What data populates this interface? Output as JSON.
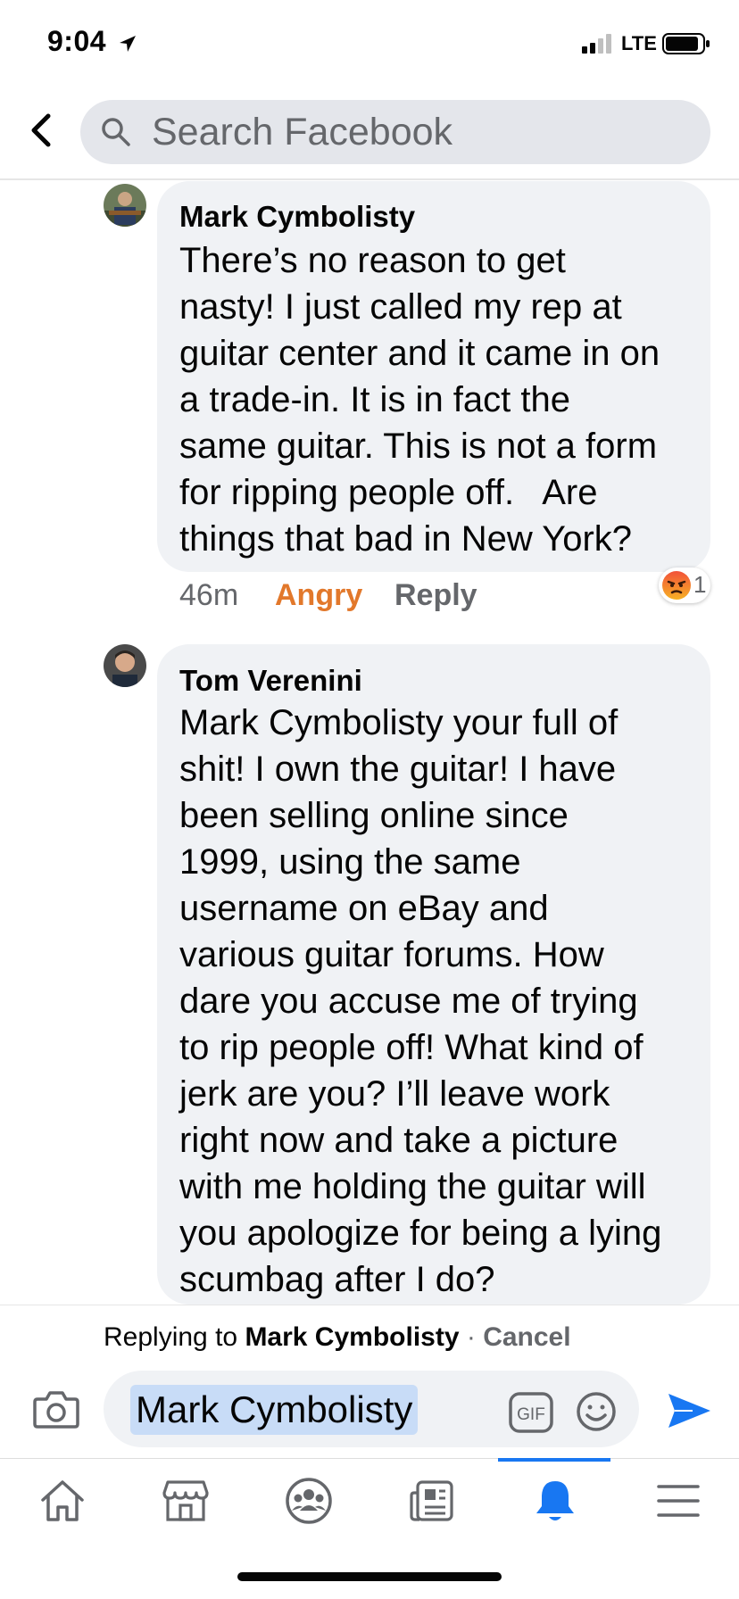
{
  "status_bar": {
    "time": "9:04",
    "network": "LTE"
  },
  "search": {
    "placeholder": "Search Facebook"
  },
  "comments": [
    {
      "author": "Mark Cymbolisty",
      "text": "There’s no reason to get\nnasty! I just called my rep at\nguitar center and it came in on\na trade-in. It is in fact the\nsame guitar. This is not a form\nfor ripping people off.   Are\nthings that bad in New York?",
      "time": "46m",
      "reaction_label": "Angry",
      "reply_label": "Reply",
      "reaction_count": "1"
    },
    {
      "author": "Tom Verenini",
      "text": "Mark Cymbolisty your full of\nshit! I own the guitar! I have\nbeen selling online since\n1999, using the same\nusername on eBay and\nvarious guitar forums. How\ndare you accuse me of trying\nto rip people off! What kind of\njerk are you? I’ll leave work\nright now and take a picture\nwith me holding the guitar will\nyou apologize for being a lying\nscumbag after I do?"
    }
  ],
  "reply_bar": {
    "prefix": "Replying to",
    "target": "Mark Cymbolisty",
    "separator": " · ",
    "cancel": "Cancel"
  },
  "composer": {
    "mention": "Mark Cymbolisty",
    "gif_label": "GIF"
  },
  "bottom_nav": {
    "items": [
      "home-icon",
      "marketplace-icon",
      "groups-icon",
      "news-icon",
      "notifications-icon",
      "menu-icon"
    ],
    "active": "notifications-icon"
  },
  "colors": {
    "accent": "#1877f2",
    "angry": "#e2782b",
    "bubble": "#f0f2f5"
  }
}
